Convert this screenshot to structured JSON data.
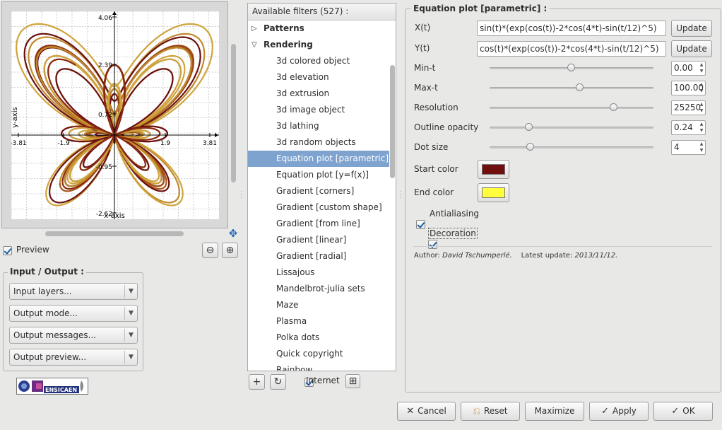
{
  "preview": {
    "y_axis_label": "y-axis",
    "x_axis_label": "x-axis",
    "y_ticks": [
      "4.06",
      "2.39",
      "0.72",
      "-0.95",
      "-2.62"
    ],
    "x_ticks": [
      "-3.81",
      "-1.9",
      "1.9",
      "3.81"
    ],
    "checkbox_label": "Preview",
    "zoom_out": "⊖",
    "zoom_in": "⊕",
    "curve_colors": [
      "#6b1010",
      "#8a2a12",
      "#a8561a",
      "#c08a2c",
      "#cfa43c"
    ]
  },
  "io": {
    "title": "Input / Output :",
    "combos": [
      "Input layers...",
      "Output mode...",
      "Output messages...",
      "Output preview..."
    ]
  },
  "logo": {
    "text": "ENSICAEN"
  },
  "filters": {
    "header": "Available filters (527) :",
    "rows": [
      {
        "label": "Patterns",
        "type": "group",
        "expanded": false
      },
      {
        "label": "Rendering",
        "type": "group",
        "expanded": true
      },
      {
        "label": "3d colored object",
        "type": "leaf"
      },
      {
        "label": "3d elevation",
        "type": "leaf"
      },
      {
        "label": "3d extrusion",
        "type": "leaf"
      },
      {
        "label": "3d image object",
        "type": "leaf"
      },
      {
        "label": "3d lathing",
        "type": "leaf"
      },
      {
        "label": "3d random objects",
        "type": "leaf"
      },
      {
        "label": "Equation plot [parametric]",
        "type": "leaf",
        "selected": true
      },
      {
        "label": "Equation plot [y=f(x)]",
        "type": "leaf"
      },
      {
        "label": "Gradient [corners]",
        "type": "leaf"
      },
      {
        "label": "Gradient [custom shape]",
        "type": "leaf"
      },
      {
        "label": "Gradient [from line]",
        "type": "leaf"
      },
      {
        "label": "Gradient [linear]",
        "type": "leaf"
      },
      {
        "label": "Gradient [radial]",
        "type": "leaf"
      },
      {
        "label": "Lissajous",
        "type": "leaf"
      },
      {
        "label": "Mandelbrot-julia sets",
        "type": "leaf"
      },
      {
        "label": "Maze",
        "type": "leaf"
      },
      {
        "label": "Plasma",
        "type": "leaf"
      },
      {
        "label": "Polka dots",
        "type": "leaf"
      },
      {
        "label": "Quick copyright",
        "type": "leaf"
      },
      {
        "label": "Rainbow",
        "type": "leaf"
      }
    ],
    "internet_label": "Internet",
    "add_glyph": "+",
    "refresh_glyph": "↻",
    "more_glyph": "⊞"
  },
  "params": {
    "title": "Equation plot [parametric] :",
    "x_label": "X(t)",
    "x_value": "sin(t)*(exp(cos(t))-2*cos(4*t)-sin(t/12)^5)",
    "y_label": "Y(t)",
    "y_value": "cos(t)*(exp(cos(t))-2*cos(4*t)-sin(t/12)^5)",
    "update_label": "Update",
    "sliders": [
      {
        "label": "Min-t",
        "value": "0.00",
        "level": 0.5
      },
      {
        "label": "Max-t",
        "value": "100.00",
        "level": 0.55
      },
      {
        "label": "Resolution",
        "value": "25250",
        "level": 0.76
      },
      {
        "label": "Outline opacity",
        "value": "0.24",
        "level": 0.24
      },
      {
        "label": "Dot size",
        "value": "4",
        "level": 0.25
      }
    ],
    "start_color_label": "Start color",
    "start_color": "#6e0e0e",
    "end_color_label": "End color",
    "end_color": "#ffff3c",
    "antialiasing_label": "Antialiasing",
    "decoration_label": "Decoration",
    "author_prefix": "Author:",
    "author": "David Tschumperlé.",
    "update_prefix": "Latest update:",
    "update_date": "2013/11/12."
  },
  "buttons": {
    "cancel": "Cancel",
    "reset": "Reset",
    "maximize": "Maximize",
    "apply": "Apply",
    "ok": "OK"
  }
}
